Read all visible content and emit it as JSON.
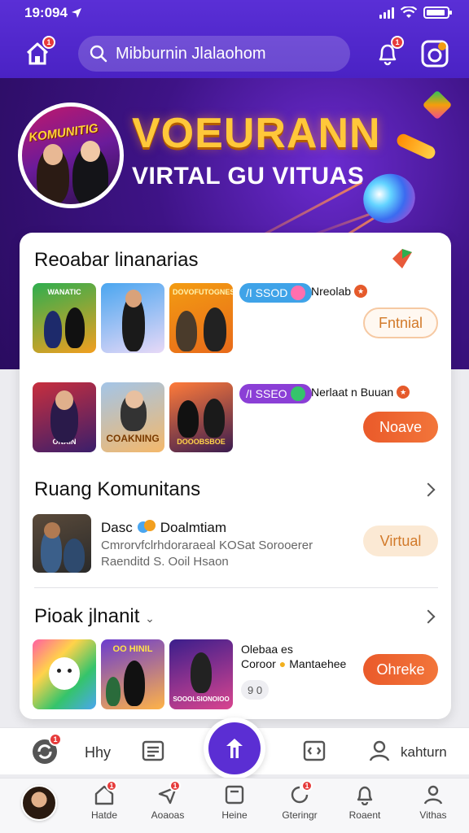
{
  "status": {
    "time": "19:0̄94",
    "time_clean": "19:094"
  },
  "header": {
    "search_placeholder": "Mibburnin Jlalaohom",
    "home_badge": "1",
    "bell_badge": "1"
  },
  "hero": {
    "photo_tag": "KOMUNITIG",
    "title": "VOEURANN",
    "subtitle": "VIRTAL GU VITUAS"
  },
  "section1": {
    "title": "Reoabar linanarias",
    "rows": [
      {
        "thumbs": [
          {
            "label": "WANATIC",
            "colors": [
              "#2eae4f",
              "#f29f1f"
            ]
          },
          {
            "label": "",
            "colors": [
              "#4aa6f0",
              "#e8d9f7"
            ]
          },
          {
            "label": "DOVOFUTOGNES",
            "colors": [
              "#f39c12",
              "#e86a1a"
            ]
          }
        ],
        "pill": "/I SSOD",
        "pill_color": "#3fa3e8",
        "name": "Nreolab",
        "button": "Fntnial",
        "button_style": "outline"
      },
      {
        "thumbs": [
          {
            "label": "ONAIN",
            "colors": [
              "#c82f3e",
              "#3a1e6b"
            ]
          },
          {
            "label": "COAKNING",
            "colors": [
              "#f4b86a",
              "#a3c5e8"
            ]
          },
          {
            "label": "DOOOBSBOE",
            "colors": [
              "#3a1c4f",
              "#ff7b3a"
            ]
          }
        ],
        "pill": "/I SSEO",
        "pill_color": "#8b3fd6",
        "name": "Nerlaat n Buuan",
        "button": "Noave",
        "button_style": "solid"
      }
    ]
  },
  "section2": {
    "title": "Ruang Komunitans",
    "item": {
      "name": "Dasc",
      "name2": "Doalmtiam",
      "line1": "Cmrorvfclrhdoraraeal KOSat Sorooerer",
      "line2": "Raenditd S. Ooil Hsaon",
      "button": "Virtual"
    }
  },
  "section3": {
    "title": "Pioak jlnanit",
    "thumbs": [
      {
        "label": "",
        "colors": [
          "#ff5fa2",
          "#ffd34a"
        ]
      },
      {
        "label": "OO HINIL",
        "colors": [
          "#6a3ccf",
          "#ffb347"
        ]
      },
      {
        "label": "SOOOLSIONOIOO",
        "colors": [
          "#3b1e8c",
          "#d9458f"
        ]
      }
    ],
    "info_line1": "Olebaa es",
    "info_line2": "Coroor",
    "info_line2b": "Mantaehee",
    "count": "9 0",
    "button": "Ohreke"
  },
  "subnav": {
    "left_label": "Hhy",
    "right_label": "kahturn"
  },
  "tabbar": [
    {
      "label": "",
      "icon": "avatar"
    },
    {
      "label": "Hatde",
      "icon": "home-icon",
      "badge": "1"
    },
    {
      "label": "Aoaoas",
      "icon": "send-icon",
      "badge": "1"
    },
    {
      "label": "Heine",
      "icon": "box-icon"
    },
    {
      "label": "Gteringr",
      "icon": "refresh-icon",
      "badge": "1"
    },
    {
      "label": "Roaent",
      "icon": "bell-icon"
    },
    {
      "label": "Vithas",
      "icon": "user-icon"
    }
  ],
  "colors": {
    "primary": "#5a2fd6",
    "accent": "#ea5a2a",
    "gold": "#ffc83a"
  }
}
